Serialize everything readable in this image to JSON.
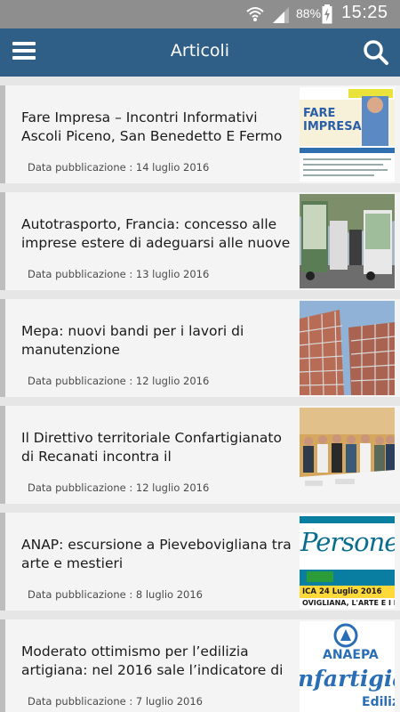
{
  "statusbar": {
    "battery_percent": "88%",
    "time": "15:25",
    "icons": [
      "wifi-icon",
      "signal-icon",
      "battery-charging-icon"
    ]
  },
  "appbar": {
    "title": "Articoli",
    "menu_icon": "hamburger-menu-icon",
    "search_icon": "search-icon",
    "background": "#2f5f86"
  },
  "articles": [
    {
      "title": "Fare Impresa – Incontri Informativi Ascoli Piceno, San Benedetto E Fermo",
      "date_label": "Data pubblicazione : 14 luglio 2016",
      "thumb_text": "FARE IMPRESA"
    },
    {
      "title": "Autotrasporto, Francia: concesso alle imprese estere di adeguarsi alle nuove",
      "date_label": "Data pubblicazione : 13 luglio 2016"
    },
    {
      "title": "Mepa: nuovi bandi per i lavori di manutenzione",
      "date_label": "Data pubblicazione : 12 luglio 2016"
    },
    {
      "title": "Il Direttivo territoriale Confartigianato di Recanati incontra il",
      "date_label": "Data pubblicazione : 12 luglio 2016"
    },
    {
      "title": "ANAP: escursione a Pievebovigliana tra arte e mestieri",
      "date_label": "Data pubblicazione : 8 luglio 2016",
      "thumb_text": "Persone",
      "thumb_subtext": "ICA 24 Luglio 2016",
      "thumb_subtext2": "OVIGLIANA, L'ARTE E I ME"
    },
    {
      "title": "Moderato ottimismo per l’edilizia artigiana: nel 2016 sale l’indicatore di",
      "date_label": "Data pubblicazione : 7 luglio 2016",
      "thumb_text": "ANAEPA",
      "thumb_subtext": "nfartigian",
      "thumb_subtext2": "Ediliz"
    }
  ]
}
